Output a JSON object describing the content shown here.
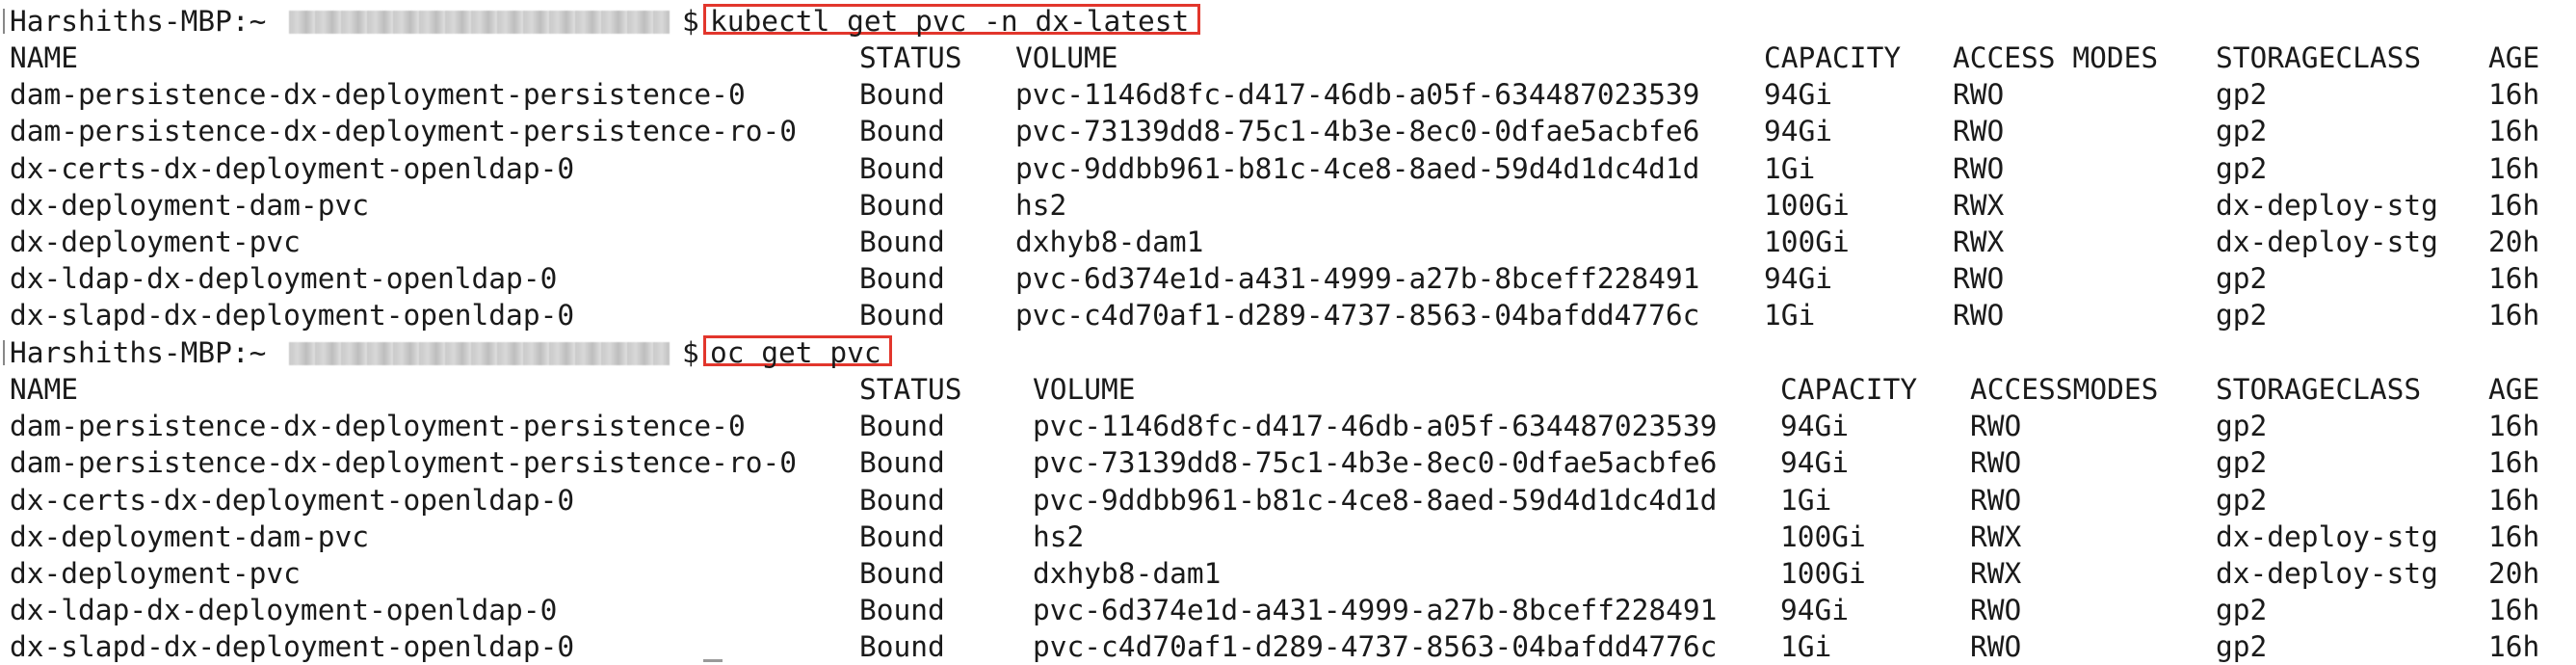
{
  "session1": {
    "prompt": "Harshiths-MBP:~",
    "dollar": "$",
    "command": "kubectl get pvc -n dx-latest",
    "headers": {
      "name": "NAME",
      "status": "STATUS",
      "volume": "VOLUME",
      "capacity": "CAPACITY",
      "access": "ACCESS MODES",
      "storage": "STORAGECLASS",
      "age": "AGE"
    },
    "rows": [
      {
        "name": "dam-persistence-dx-deployment-persistence-0",
        "status": "Bound",
        "volume": "pvc-1146d8fc-d417-46db-a05f-634487023539",
        "capacity": "94Gi",
        "access": "RWO",
        "storage": "gp2",
        "age": "16h"
      },
      {
        "name": "dam-persistence-dx-deployment-persistence-ro-0",
        "status": "Bound",
        "volume": "pvc-73139dd8-75c1-4b3e-8ec0-0dfae5acbfe6",
        "capacity": "94Gi",
        "access": "RWO",
        "storage": "gp2",
        "age": "16h"
      },
      {
        "name": "dx-certs-dx-deployment-openldap-0",
        "status": "Bound",
        "volume": "pvc-9ddbb961-b81c-4ce8-8aed-59d4d1dc4d1d",
        "capacity": "1Gi",
        "access": "RWO",
        "storage": "gp2",
        "age": "16h"
      },
      {
        "name": "dx-deployment-dam-pvc",
        "status": "Bound",
        "volume": "hs2",
        "capacity": "100Gi",
        "access": "RWX",
        "storage": "dx-deploy-stg",
        "age": "16h"
      },
      {
        "name": "dx-deployment-pvc",
        "status": "Bound",
        "volume": "dxhyb8-dam1",
        "capacity": "100Gi",
        "access": "RWX",
        "storage": "dx-deploy-stg",
        "age": "20h"
      },
      {
        "name": "dx-ldap-dx-deployment-openldap-0",
        "status": "Bound",
        "volume": "pvc-6d374e1d-a431-4999-a27b-8bceff228491",
        "capacity": "94Gi",
        "access": "RWO",
        "storage": "gp2",
        "age": "16h"
      },
      {
        "name": "dx-slapd-dx-deployment-openldap-0",
        "status": "Bound",
        "volume": "pvc-c4d70af1-d289-4737-8563-04bafdd4776c",
        "capacity": "1Gi",
        "access": "RWO",
        "storage": "gp2",
        "age": "16h"
      }
    ]
  },
  "session2": {
    "prompt": "Harshiths-MBP:~",
    "dollar": "$",
    "command": "oc get pvc",
    "headers": {
      "name": "NAME",
      "status": "STATUS",
      "volume": "VOLUME",
      "capacity": "CAPACITY",
      "access": "ACCESSMODES",
      "storage": "STORAGECLASS",
      "age": "AGE"
    },
    "rows": [
      {
        "name": "dam-persistence-dx-deployment-persistence-0",
        "status": "Bound",
        "volume": "pvc-1146d8fc-d417-46db-a05f-634487023539",
        "capacity": "94Gi",
        "access": "RWO",
        "storage": "gp2",
        "age": "16h"
      },
      {
        "name": "dam-persistence-dx-deployment-persistence-ro-0",
        "status": "Bound",
        "volume": "pvc-73139dd8-75c1-4b3e-8ec0-0dfae5acbfe6",
        "capacity": "94Gi",
        "access": "RWO",
        "storage": "gp2",
        "age": "16h"
      },
      {
        "name": "dx-certs-dx-deployment-openldap-0",
        "status": "Bound",
        "volume": "pvc-9ddbb961-b81c-4ce8-8aed-59d4d1dc4d1d",
        "capacity": "1Gi",
        "access": "RWO",
        "storage": "gp2",
        "age": "16h"
      },
      {
        "name": "dx-deployment-dam-pvc",
        "status": "Bound",
        "volume": "hs2",
        "capacity": "100Gi",
        "access": "RWX",
        "storage": "dx-deploy-stg",
        "age": "16h"
      },
      {
        "name": "dx-deployment-pvc",
        "status": "Bound",
        "volume": "dxhyb8-dam1",
        "capacity": "100Gi",
        "access": "RWX",
        "storage": "dx-deploy-stg",
        "age": "20h"
      },
      {
        "name": "dx-ldap-dx-deployment-openldap-0",
        "status": "Bound",
        "volume": "pvc-6d374e1d-a431-4999-a27b-8bceff228491",
        "capacity": "94Gi",
        "access": "RWO",
        "storage": "gp2",
        "age": "16h"
      },
      {
        "name": "dx-slapd-dx-deployment-openldap-0",
        "status": "Bound",
        "volume": "pvc-c4d70af1-d289-4737-8563-04bafdd4776c",
        "capacity": "1Gi",
        "access": "RWO",
        "storage": "gp2",
        "age": "16h"
      }
    ]
  },
  "colors": {
    "highlight_box": "#e2362c",
    "text": "#1a1a1a",
    "background": "#ffffff"
  }
}
